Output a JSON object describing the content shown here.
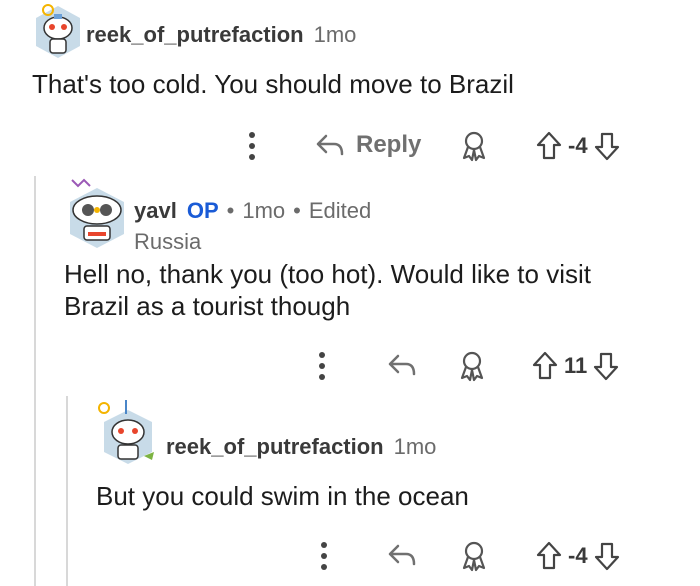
{
  "comments": [
    {
      "username": "reek_of_putrefaction",
      "time": "1mo",
      "body": "That's too cold. You should move to Brazil",
      "reply_label": "Reply",
      "score": "-4"
    },
    {
      "username": "yavl",
      "op_badge": "OP",
      "time": "1mo",
      "edited": "Edited",
      "flair": "Russia",
      "body_line1": "Hell no, thank you (too hot). Would like to visit",
      "body_line2": "Brazil as a tourist though",
      "score": "11"
    },
    {
      "username": "reek_of_putrefaction",
      "time": "1mo",
      "body": "But you could swim in the ocean",
      "score": "-4"
    }
  ],
  "colors": {
    "text": "#1c1c1c",
    "meta": "#6b6b6b",
    "op_blue": "#1a5bd6",
    "icon": "#707070",
    "thread_line": "#d8d8d8"
  },
  "icons": [
    "more-options-icon",
    "reply-arrow-icon",
    "award-icon",
    "upvote-arrow-icon",
    "downvote-arrow-icon"
  ]
}
